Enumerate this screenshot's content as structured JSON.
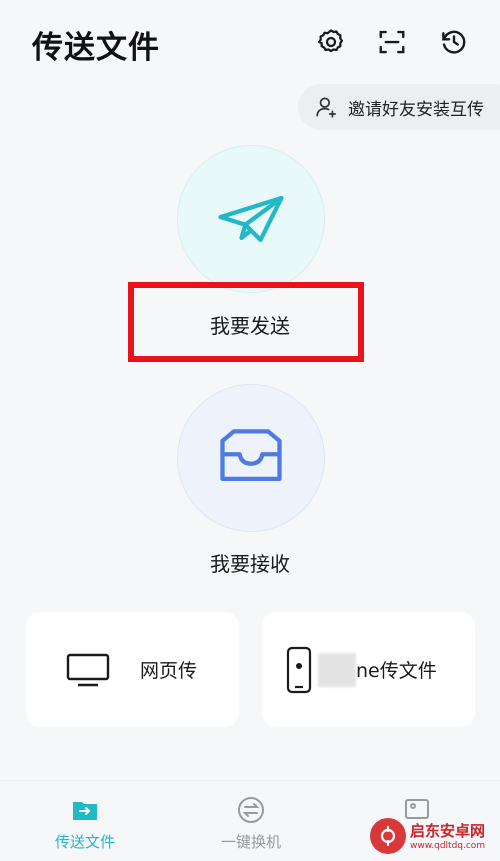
{
  "header": {
    "title": "传送文件",
    "icons": [
      "gear-icon",
      "scan-icon",
      "history-icon"
    ]
  },
  "invite": {
    "label": "邀请好友安装互传",
    "icon": "add-user-icon"
  },
  "actions": {
    "send_label": "我要发送",
    "receive_label": "我要接收",
    "send_icon": "paper-plane-icon",
    "receive_icon": "inbox-icon"
  },
  "cards": {
    "web": {
      "label": "网页传",
      "icon": "monitor-icon"
    },
    "iphone": {
      "label": "ne传文件",
      "icon": "iphone-icon"
    }
  },
  "bottom_nav": {
    "items": [
      {
        "label": "传送文件",
        "icon": "folder-transfer-icon",
        "active": true
      },
      {
        "label": "一键换机",
        "icon": "swap-icon",
        "active": false
      },
      {
        "label": "",
        "icon": "image-icon",
        "active": false
      }
    ]
  },
  "watermark": {
    "name": "启东安卓网",
    "url": "www.qdltdq.com"
  },
  "colors": {
    "accent": "#22b8c6",
    "send_circle": "#e9f8f8",
    "receive_circle": "#eef3fb",
    "receive_icon": "#4f7be0",
    "highlight": "#e8131b"
  }
}
